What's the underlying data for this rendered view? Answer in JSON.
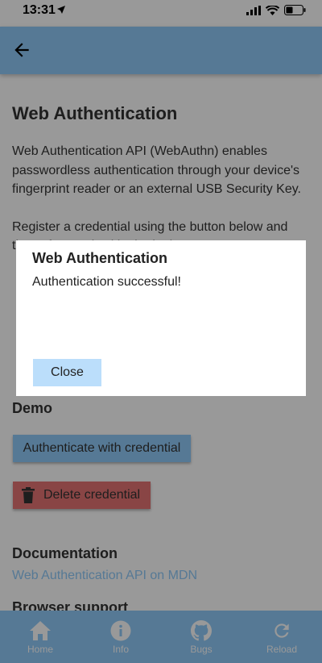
{
  "status_bar": {
    "time": "13:31"
  },
  "page": {
    "title": "Web Authentication",
    "intro": "Web Authentication API (WebAuthn) enables passwordless authentication through your device's fingerprint reader or an external USB Security Key.",
    "register": "Register a credential using the button below and then afterwards skip the login ...",
    "demo_heading": "Demo",
    "auth_button": "Authenticate with credential",
    "delete_button": "Delete credential",
    "doc_heading": "Documentation",
    "doc_link": "Web Authentication API on MDN",
    "support_heading": "Browser support"
  },
  "dialog": {
    "title": "Web Authentication",
    "message": "Authentication successful!",
    "close_label": "Close"
  },
  "nav": [
    {
      "label": "Home",
      "icon": "home-icon"
    },
    {
      "label": "Info",
      "icon": "info-icon"
    },
    {
      "label": "Bugs",
      "icon": "github-icon"
    },
    {
      "label": "Reload",
      "icon": "reload-icon"
    }
  ],
  "colors": {
    "primary": "#90caf9",
    "danger": "#e57373",
    "dialog_button": "#bbdefb"
  }
}
